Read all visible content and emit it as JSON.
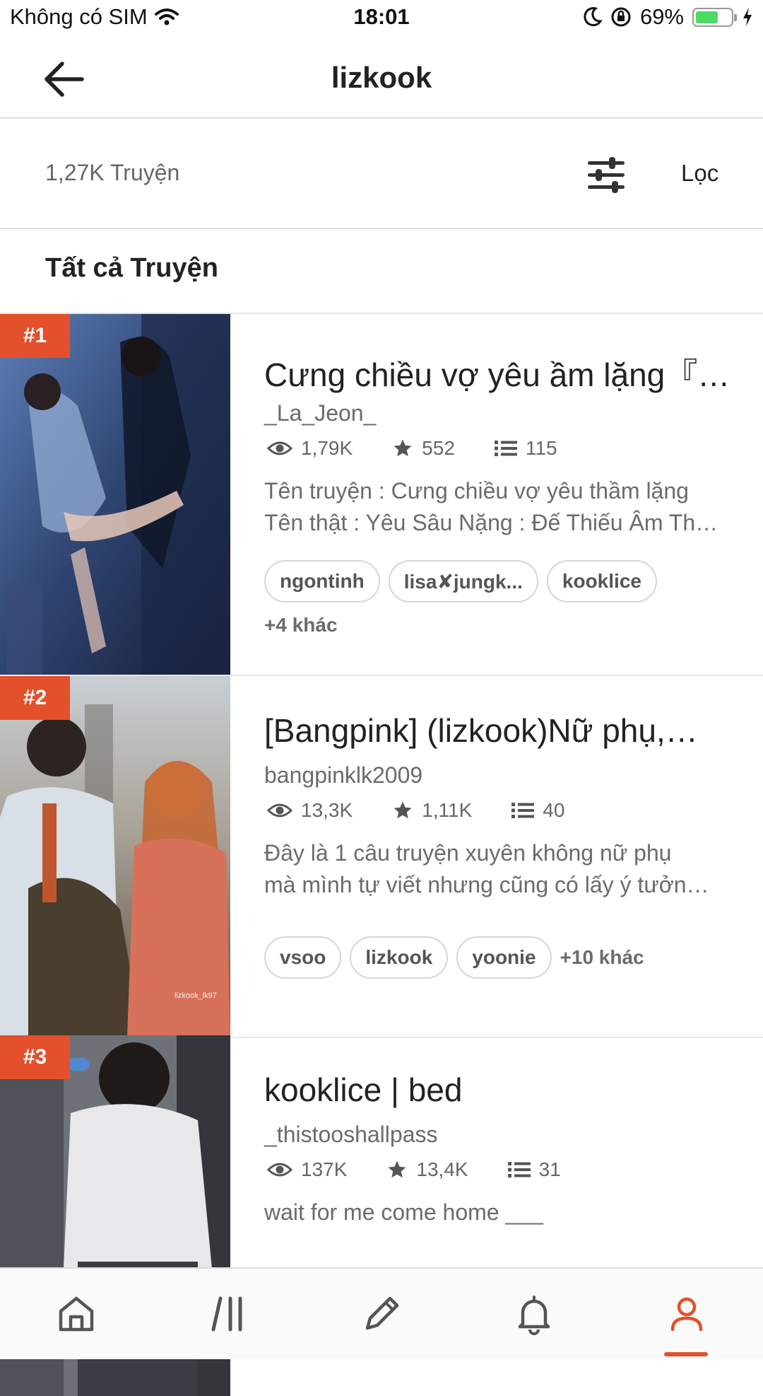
{
  "status_bar": {
    "carrier": "Không có SIM",
    "time": "18:01",
    "battery": "69%",
    "battery_level": 0.69
  },
  "header": {
    "title": "lizkook"
  },
  "filter": {
    "count": "1,27K Truyện",
    "label": "Lọc"
  },
  "section_title": "Tất cả Truyện",
  "stories": [
    {
      "rank": "#1",
      "title": "Cưng chiều vợ yêu ầm lặng『…",
      "author": "_La_Jeon_",
      "views": "1,79K",
      "votes": "552",
      "parts": "115",
      "description": [
        "Tên truyện : Cưng chiều vợ yêu thầm lặng",
        "Tên thật : Yêu Sâu Nặng : Đế Thiếu Âm Th…"
      ],
      "tags": [
        "ngontinh",
        "lisa✘jungk...",
        "kooklice"
      ],
      "more_tags": "+4 khác"
    },
    {
      "rank": "#2",
      "title": "[Bangpink] (lizkook)Nữ phụ,…",
      "author": "bangpinklk2009",
      "views": "13,3K",
      "votes": "1,11K",
      "parts": "40",
      "description": [
        "Đây là 1 câu truyện xuyên không nữ phụ",
        "mà mình tự viết nhưng cũng có lấy ý tưởn…"
      ],
      "tags": [
        "vsoo",
        "lizkook",
        "yoonie"
      ],
      "more_tags": "+10 khác",
      "cover_caption": "lizkook_lk97"
    },
    {
      "rank": "#3",
      "title": "kooklice | bed",
      "author": "_thistooshallpass",
      "views": "137K",
      "votes": "13,4K",
      "parts": "31",
      "description": [
        "wait for me come home ___"
      ]
    }
  ],
  "bottom_nav": [
    "home-icon",
    "library-icon",
    "write-icon",
    "notifications-icon",
    "profile-icon"
  ],
  "colors": {
    "accent": "#e4502b"
  }
}
